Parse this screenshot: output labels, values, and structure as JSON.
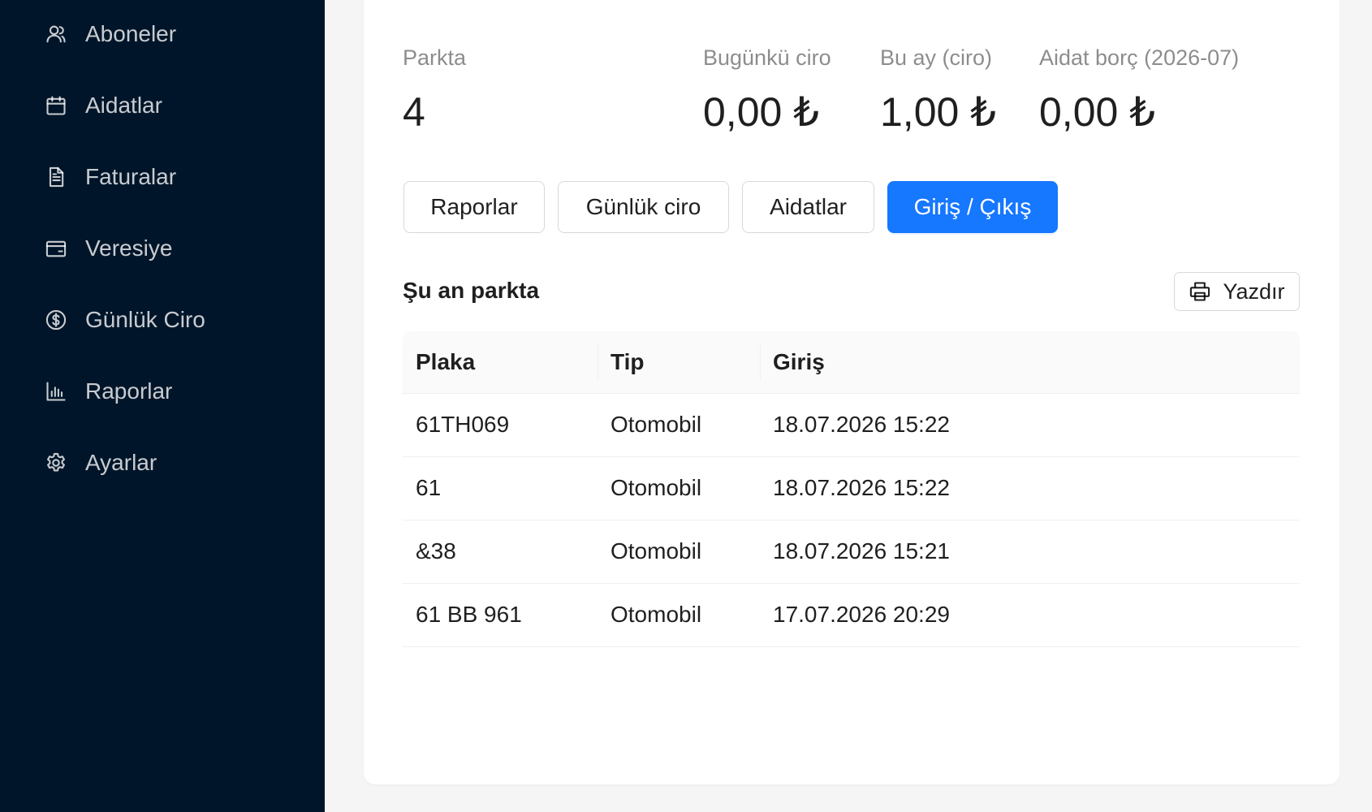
{
  "sidebar": {
    "items": [
      {
        "label": "Aboneler",
        "icon": "user-icon"
      },
      {
        "label": "Aidatlar",
        "icon": "calendar-icon"
      },
      {
        "label": "Faturalar",
        "icon": "document-icon"
      },
      {
        "label": "Veresiye",
        "icon": "wallet-icon"
      },
      {
        "label": "Günlük Ciro",
        "icon": "dollar-circle-icon"
      },
      {
        "label": "Raporlar",
        "icon": "bar-chart-icon"
      },
      {
        "label": "Ayarlar",
        "icon": "gear-icon"
      }
    ]
  },
  "stats": [
    {
      "label": "Parkta",
      "value": "4"
    },
    {
      "label": "Bugünkü ciro",
      "value": "0,00 ₺"
    },
    {
      "label": "Bu ay (ciro)",
      "value": "1,00 ₺"
    },
    {
      "label": "Aidat borç (2026-07)",
      "value": "0,00 ₺"
    }
  ],
  "actions": [
    {
      "label": "Raporlar"
    },
    {
      "label": "Günlük ciro"
    },
    {
      "label": "Aidatlar"
    },
    {
      "label": "Giriş / Çıkış"
    }
  ],
  "section": {
    "title": "Şu an parkta",
    "print_label": "Yazdır",
    "print_icon": "printer-icon"
  },
  "table": {
    "headers": [
      "Plaka",
      "Tip",
      "Giriş"
    ],
    "rows": [
      [
        "61TH069",
        "Otomobil",
        "18.07.2026 15:22"
      ],
      [
        "61",
        "Otomobil",
        "18.07.2026 15:22"
      ],
      [
        "&38",
        "Otomobil",
        "18.07.2026 15:21"
      ],
      [
        "61 BB 961",
        "Otomobil",
        "17.07.2026 20:29"
      ]
    ]
  },
  "colors": {
    "sidebar_bg": "#001529",
    "primary": "#1677ff"
  }
}
